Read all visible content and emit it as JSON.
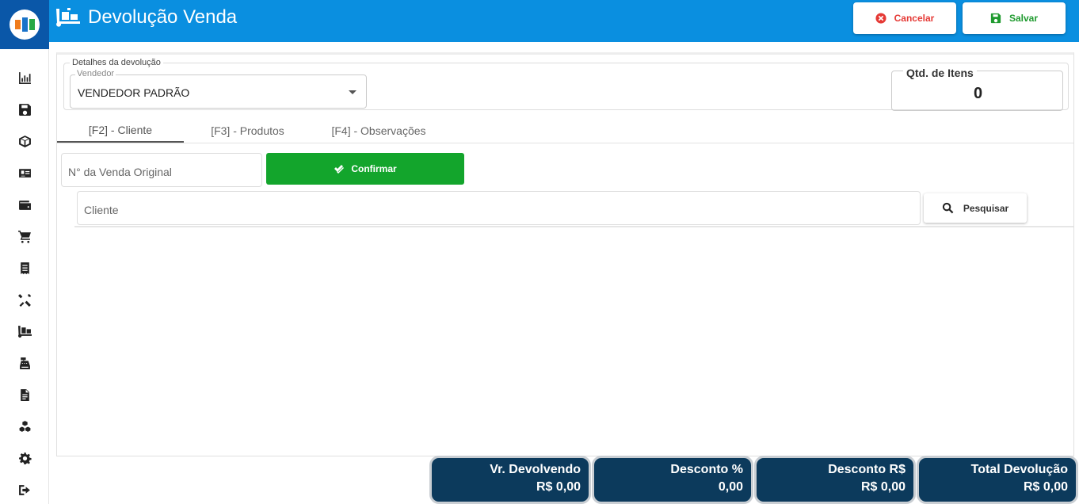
{
  "app": {
    "title": "Devolução Venda",
    "colors": {
      "topbar": "#0a8fe0",
      "cancel": "#e53935",
      "save": "#1e9a2e",
      "confirm": "#13a52c",
      "totals_bg": "#0c3a5c"
    }
  },
  "sidebar": {
    "items": [
      {
        "icon": "chart-icon"
      },
      {
        "icon": "save-icon"
      },
      {
        "icon": "box-icon"
      },
      {
        "icon": "id-card-icon"
      },
      {
        "icon": "wallet-icon"
      },
      {
        "icon": "cart-icon"
      },
      {
        "icon": "receipt-icon"
      },
      {
        "icon": "tools-icon"
      },
      {
        "icon": "dolly-icon"
      },
      {
        "icon": "cash-register-icon"
      },
      {
        "icon": "document-icon"
      },
      {
        "icon": "boxes-icon"
      },
      {
        "icon": "gear-icon"
      },
      {
        "icon": "logout-icon"
      }
    ]
  },
  "toolbar": {
    "cancel_label": "Cancelar",
    "save_label": "Salvar"
  },
  "details": {
    "legend": "Detalhes da devolução",
    "vendedor_label": "Vendedor",
    "vendedor_value": "VENDEDOR PADRÃO",
    "qty_label": "Qtd. de Itens",
    "qty_value": "0"
  },
  "tabs": [
    {
      "label": "[F2] - Cliente"
    },
    {
      "label": "[F3] - Produtos"
    },
    {
      "label": "[F4] - Observações"
    }
  ],
  "cliente_tab": {
    "venda_placeholder": "N° da Venda Original",
    "confirm_label": "Confirmar",
    "cliente_placeholder": "Cliente",
    "search_label": "Pesquisar"
  },
  "totals": [
    {
      "label": "Vr. Devolvendo",
      "value": "R$ 0,00"
    },
    {
      "label": "Desconto %",
      "value": "0,00"
    },
    {
      "label": "Desconto R$",
      "value": "R$ 0,00"
    },
    {
      "label": "Total Devolução",
      "value": "R$ 0,00"
    }
  ]
}
